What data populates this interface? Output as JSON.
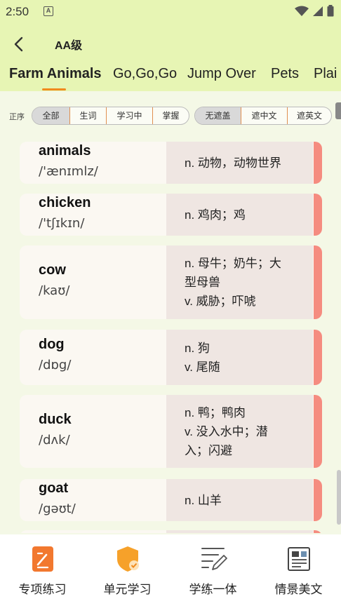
{
  "status": {
    "time": "2:50",
    "notif": "A"
  },
  "header": {
    "title": "AA级"
  },
  "tabs": [
    {
      "label": "Farm Animals"
    },
    {
      "label": "Go,Go,Go"
    },
    {
      "label": "Jump Over"
    },
    {
      "label": "Pets"
    },
    {
      "label": "Plai"
    }
  ],
  "filters": {
    "order_label": "正序",
    "group1": [
      "全部",
      "生词",
      "学习中",
      "掌握"
    ],
    "group2": [
      "无遮盖",
      "遮中文",
      "遮英文"
    ]
  },
  "words": [
    {
      "word": "animals",
      "phonetic": "/'ænɪmlz/",
      "defs": [
        "n. 动物，动物世界"
      ]
    },
    {
      "word": "chicken",
      "phonetic": "/'tʃɪkɪn/",
      "defs": [
        "n. 鸡肉；鸡"
      ]
    },
    {
      "word": "cow",
      "phonetic": "/kaʊ/",
      "defs": [
        "n. 母牛；奶牛；大",
        "型母兽",
        "v. 威胁；吓唬"
      ]
    },
    {
      "word": "dog",
      "phonetic": "/dɒg/",
      "defs": [
        "n. 狗",
        "v. 尾随"
      ]
    },
    {
      "word": "duck",
      "phonetic": "/dʌk/",
      "defs": [
        "n. 鸭；鸭肉",
        "v. 没入水中；潜",
        "入；闪避"
      ]
    },
    {
      "word": "goat",
      "phonetic": "/gəʊt/",
      "defs": [
        "n. 山羊"
      ]
    }
  ],
  "bottom_nav": [
    {
      "label": "专项练习",
      "icon": "practice-icon"
    },
    {
      "label": "单元学习",
      "icon": "shield-check-icon"
    },
    {
      "label": "学练一体",
      "icon": "edit-lines-icon"
    },
    {
      "label": "情景美文",
      "icon": "newspaper-icon"
    }
  ],
  "colors": {
    "header_bg": "#e7f5b4",
    "accent": "#f08a1e",
    "card_bar": "#f58c80"
  }
}
